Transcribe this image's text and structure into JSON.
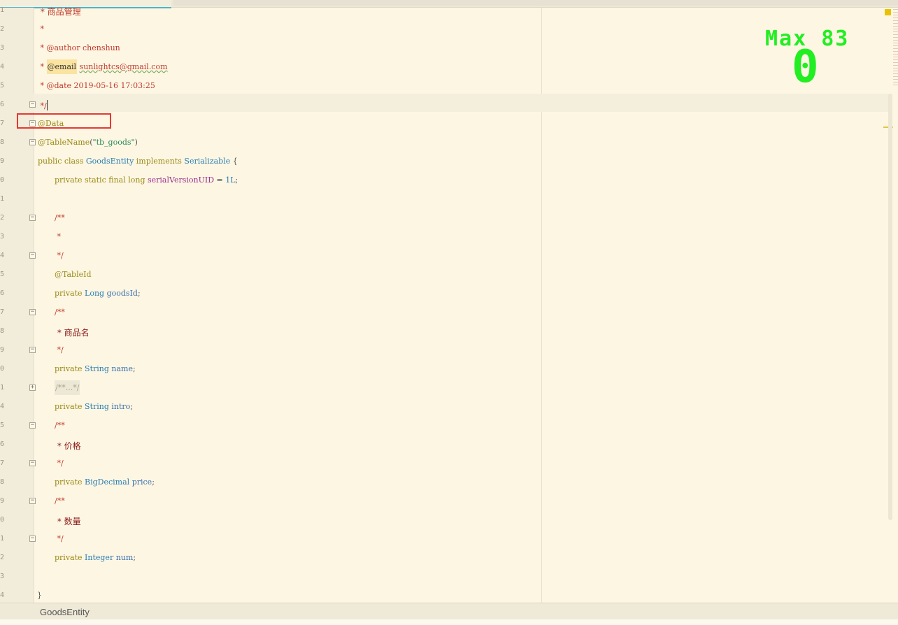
{
  "status": {
    "breadcrumb": "GoodsEntity"
  },
  "overlay": {
    "max_label": "Max 83",
    "score": "0"
  },
  "lines": [
    {
      "n": "1"
    },
    {
      "n": "2"
    },
    {
      "n": "3"
    },
    {
      "n": "4"
    },
    {
      "n": "5"
    },
    {
      "n": "6"
    },
    {
      "n": "7"
    },
    {
      "n": "8"
    },
    {
      "n": "9"
    },
    {
      "n": "0"
    },
    {
      "n": "1"
    },
    {
      "n": "2"
    },
    {
      "n": "3"
    },
    {
      "n": "4"
    },
    {
      "n": "5"
    },
    {
      "n": "6"
    },
    {
      "n": "7"
    },
    {
      "n": "8"
    },
    {
      "n": "9"
    },
    {
      "n": "0"
    },
    {
      "n": "1"
    },
    {
      "n": "4"
    },
    {
      "n": "5"
    },
    {
      "n": "6"
    },
    {
      "n": "7"
    },
    {
      "n": "8"
    },
    {
      "n": "9"
    },
    {
      "n": "0"
    },
    {
      "n": "1"
    },
    {
      "n": "2"
    },
    {
      "n": "3"
    },
    {
      "n": "4"
    }
  ],
  "code": {
    "l1": " * 商品管理",
    "l2": " *",
    "l3": " * @author chenshun",
    "l4_star": " * ",
    "l4_tag": "@email",
    "l4_val": "sunlightcs@gmail.com",
    "l5": " * @date 2019-05-16 17:03:25",
    "l6": " */",
    "l7": "@Data",
    "l8_ann": "@TableName",
    "l8_open": "(",
    "l8_str": "\"tb_goods\"",
    "l8_close": ")",
    "l9_kw": "public class ",
    "l9_name": "GoodsEntity",
    "l9_impl": " implements ",
    "l9_iface": "Serializable",
    "l9_brace": " {",
    "l10_kw": "private static final long ",
    "l10_field": "serialVersionUID",
    "l10_eq": " = ",
    "l10_num": "1L",
    "l10_semi": ";",
    "c_open": "/**",
    "c_star": " *",
    "c_close": " */",
    "tableid": "@TableId",
    "priv": "private ",
    "t_long": "Long",
    "f_goodsid": " goodsId",
    "semi": ";",
    "cn_name": " * 商品名",
    "t_string": "String",
    "f_name": " name",
    "folded": "/**...*/",
    "f_intro": " intro",
    "cn_price": " * 价格",
    "t_bigdec": "BigDecimal",
    "f_price": " price",
    "cn_num": " * 数量",
    "t_integer": "Integer",
    "f_num": " num",
    "close_brace": "}"
  },
  "colors": {
    "background": "#fdf6e3",
    "comment": "#c0392b",
    "annotation": "#9a8a14",
    "type": "#2a7fb3",
    "highlight_box": "#e53935",
    "overlay_text": "#22ee22"
  }
}
